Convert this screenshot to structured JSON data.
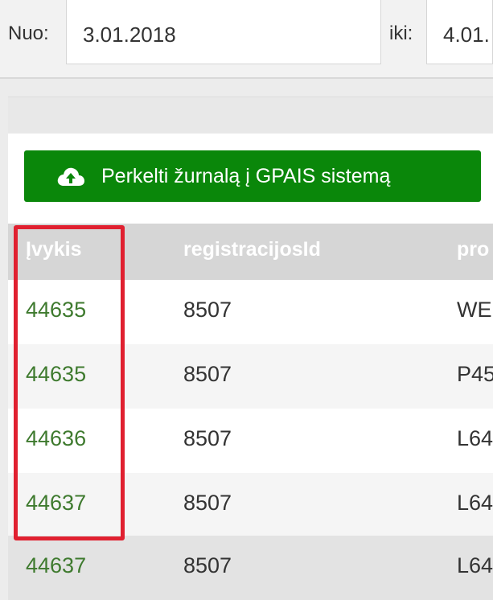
{
  "filters": {
    "from_label": "Nuo:",
    "from_value": "3.01.2018",
    "to_label": "iki:",
    "to_value": "4.01."
  },
  "toolbar": {
    "transfer_button_label": "Perkelti žurnalą į GPAIS sistemą",
    "transfer_button_icon": "cloud-upload-icon",
    "button_color": "#0a870a"
  },
  "table": {
    "columns": [
      "Įvykis",
      "registracijosId",
      "pro"
    ],
    "rows": [
      {
        "ivykis": "44635",
        "registracijos_id": "8507",
        "pro": "WE"
      },
      {
        "ivykis": "44635",
        "registracijos_id": "8507",
        "pro": "P45"
      },
      {
        "ivykis": "44636",
        "registracijos_id": "8507",
        "pro": "L64"
      },
      {
        "ivykis": "44637",
        "registracijos_id": "8507",
        "pro": "L64"
      },
      {
        "ivykis": "44637",
        "registracijos_id": "8507",
        "pro": "L64"
      }
    ]
  },
  "annotation": {
    "highlight_color": "#e02030"
  }
}
